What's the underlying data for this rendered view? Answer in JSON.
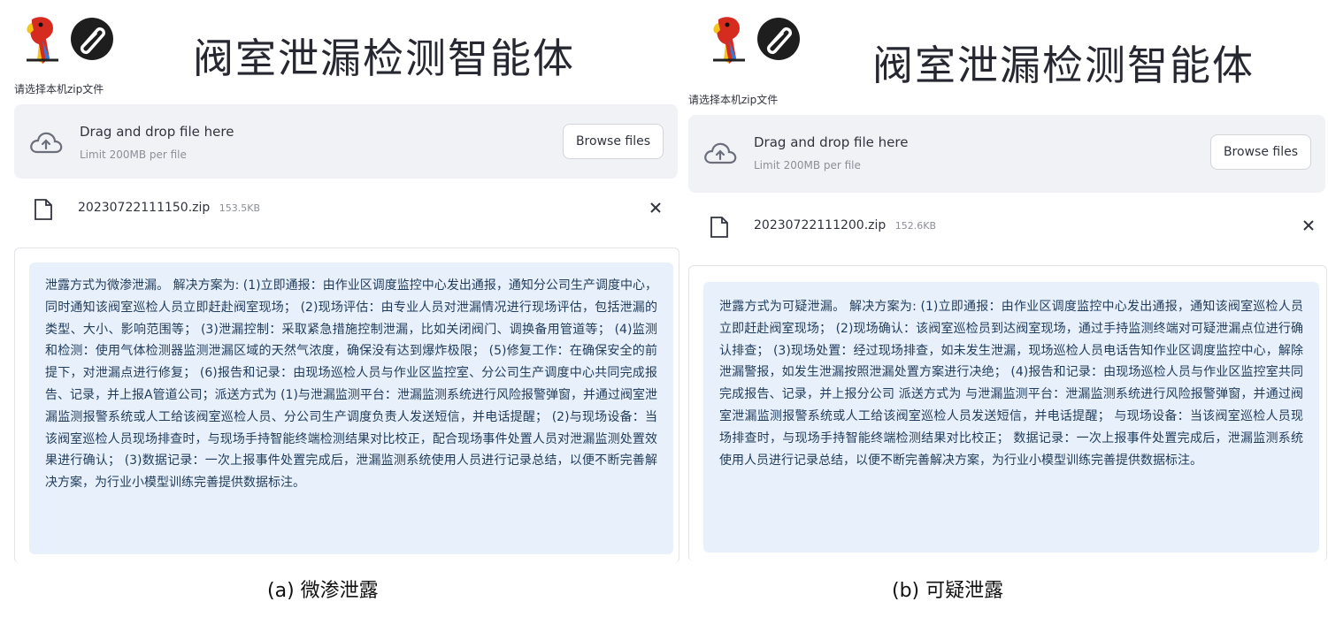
{
  "panels": [
    {
      "title": "阀室泄漏检测智能体",
      "upload_label": "请选择本机zip文件",
      "dropzone": {
        "main": "Drag and drop file here",
        "sub": "Limit 200MB per file",
        "browse": "Browse files"
      },
      "file": {
        "name": "20230722111150.zip",
        "size": "153.5KB"
      },
      "result": "泄露方式为微渗泄漏。 解决方案为: (1)立即通报：由作业区调度监控中心发出通报，通知分公司生产调度中心，同时通知该阀室巡检人员立即赶赴阀室现场； (2)现场评估：由专业人员对泄漏情况进行现场评估，包括泄漏的类型、大小、影响范围等； (3)泄漏控制：采取紧急措施控制泄漏，比如关闭阀门、调换备用管道等； (4)监测和检测：使用气体检测器监测泄漏区域的天然气浓度，确保没有达到爆炸极限； (5)修复工作：在确保安全的前提下，对泄漏点进行修复； (6)报告和记录：由现场巡检人员与作业区监控室、分公司生产调度中心共同完成报告、记录，并上报A管道公司；派送方式为 (1)与泄漏监测平台：泄漏监测系统进行风险报警弹窗，并通过阀室泄漏监测报警系统或人工给该阀室巡检人员、分公司生产调度负责人发送短信，并电话提醒； (2)与现场设备：当该阀室巡检人员现场排查时，与现场手持智能终端检测结果对比校正，配合现场事件处置人员对泄漏监测处置效果进行确认； (3)数据记录：一次上报事件处置完成后，泄漏监测系统使用人员进行记录总结，以便不断完善解决方案，为行业小模型训练完善提供数据标注。"
    },
    {
      "title": "阀室泄漏检测智能体",
      "upload_label": "请选择本机zip文件",
      "dropzone": {
        "main": "Drag and drop file here",
        "sub": "Limit 200MB per file",
        "browse": "Browse files"
      },
      "file": {
        "name": "20230722111200.zip",
        "size": "152.6KB"
      },
      "result": "泄露方式为可疑泄漏。 解决方案为: (1)立即通报：由作业区调度监控中心发出通报，通知该阀室巡检人员立即赶赴阀室现场； (2)现场确认：该阀室巡检员到达阀室现场，通过手持监测终端对可疑泄漏点位进行确认排查； (3)现场处置：经过现场排查，如未发生泄漏，现场巡检人员电话告知作业区调度监控中心，解除泄漏警报，如发生泄漏按照泄漏处置方案进行决绝； (4)报告和记录：由现场巡检人员与作业区监控室共同完成报告、记录，并上报分公司 派送方式为 与泄漏监测平台：泄漏监测系统进行风险报警弹窗，并通过阀室泄漏监测报警系统或人工给该阀室巡检人员发送短信，并电话提醒； 与现场设备：当该阀室巡检人员现场排查时，与现场手持智能终端检测结果对比校正； 数据记录：一次上报事件处置完成后，泄漏监测系统使用人员进行记录总结，以便不断完善解决方案，为行业小模型训练完善提供数据标注。"
    }
  ],
  "captions": [
    "(a) 微渗泄露",
    "(b) 可疑泄露"
  ],
  "colors": {
    "dropzone_bg": "#f0f2f6",
    "alert_bg": "#e8f1fb",
    "alert_text": "#1f3b5c"
  },
  "icons": [
    "parrot-logo-icon",
    "paperclip-logo-icon",
    "cloud-upload-icon",
    "file-icon",
    "close-icon"
  ]
}
